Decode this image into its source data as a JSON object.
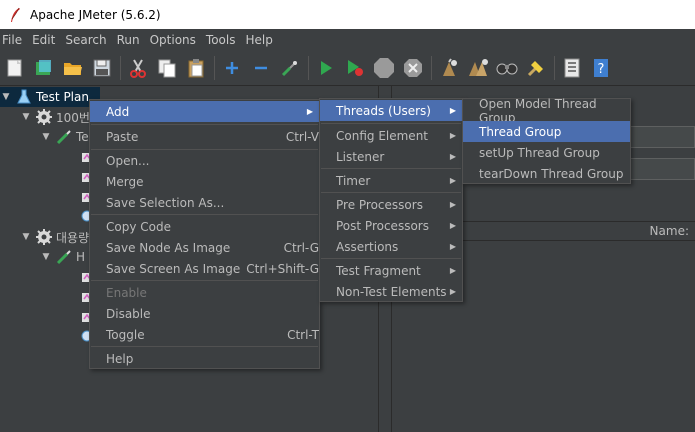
{
  "window": {
    "title": "Apache JMeter (5.6.2)"
  },
  "menubar": [
    "File",
    "Edit",
    "Search",
    "Run",
    "Options",
    "Tools",
    "Help"
  ],
  "toolbar": [
    {
      "icon": "new-icon"
    },
    {
      "icon": "templates-icon"
    },
    {
      "icon": "open-icon"
    },
    {
      "icon": "save-icon"
    },
    {
      "icon": "cut-icon"
    },
    {
      "icon": "copy-icon"
    },
    {
      "icon": "paste-icon"
    },
    {
      "icon": "expand-icon"
    },
    {
      "icon": "collapse-icon"
    },
    {
      "icon": "toggle-icon"
    },
    {
      "icon": "start-icon"
    },
    {
      "icon": "start-no-pauses-icon"
    },
    {
      "icon": "stop-icon"
    },
    {
      "icon": "shutdown-icon"
    },
    {
      "icon": "clear-icon"
    },
    {
      "icon": "clear-all-icon"
    },
    {
      "icon": "search-icon"
    },
    {
      "icon": "reset-search-icon"
    },
    {
      "icon": "function-helper-icon"
    },
    {
      "icon": "help-icon"
    }
  ],
  "tree": {
    "nodes": [
      {
        "label": "Test Plan",
        "icon": "test-plan-icon",
        "selected": true
      },
      {
        "label": "100번",
        "icon": "thread-group-gear-icon"
      },
      {
        "label": "Te",
        "icon": "sampler-pen-icon"
      },
      {
        "label": "대용량",
        "icon": "thread-group-gear-icon"
      },
      {
        "label": "H",
        "icon": "sampler-pen-icon"
      }
    ]
  },
  "right_pane": {
    "column_header": "Name:"
  },
  "context_menu": {
    "items": [
      {
        "label": "Add",
        "accelerator": "",
        "submenu": true,
        "active": true
      },
      {
        "label": "Paste",
        "accelerator": "Ctrl-V"
      },
      {
        "label": "Open...",
        "accelerator": ""
      },
      {
        "label": "Merge",
        "accelerator": ""
      },
      {
        "label": "Save Selection As...",
        "accelerator": ""
      },
      {
        "label": "Copy Code",
        "accelerator": ""
      },
      {
        "label": "Save Node As Image",
        "accelerator": "Ctrl-G"
      },
      {
        "label": "Save Screen As Image",
        "accelerator": "Ctrl+Shift-G"
      },
      {
        "label": "Enable",
        "accelerator": "",
        "disabled": true
      },
      {
        "label": "Disable",
        "accelerator": ""
      },
      {
        "label": "Toggle",
        "accelerator": "Ctrl-T"
      },
      {
        "label": "Help",
        "accelerator": ""
      }
    ]
  },
  "add_submenu": {
    "items": [
      {
        "label": "Threads (Users)",
        "active": true
      },
      {
        "label": "Config Element"
      },
      {
        "label": "Listener"
      },
      {
        "label": "Timer"
      },
      {
        "label": "Pre Processors"
      },
      {
        "label": "Post Processors"
      },
      {
        "label": "Assertions"
      },
      {
        "label": "Test Fragment"
      },
      {
        "label": "Non-Test Elements"
      }
    ]
  },
  "threads_submenu": {
    "items": [
      {
        "label": "Open Model Thread Group"
      },
      {
        "label": "Thread Group",
        "active": true
      },
      {
        "label": "setUp Thread Group"
      },
      {
        "label": "tearDown Thread Group"
      }
    ]
  },
  "colors": {
    "menu_highlight": "#4b6eaf",
    "background": "#3c3f41",
    "tree_selection": "#0d293e"
  }
}
